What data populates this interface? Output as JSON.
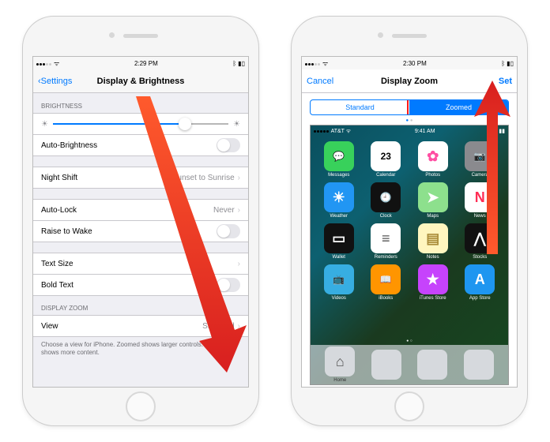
{
  "left": {
    "status": {
      "time": "2:29 PM",
      "signal_dots": 5,
      "signal_filled": 3,
      "wifi": "wifi",
      "battery": "battery"
    },
    "nav": {
      "back": "Settings",
      "title": "Display & Brightness"
    },
    "brightness": {
      "header": "BRIGHTNESS",
      "auto_label": "Auto-Brightness"
    },
    "night_shift": {
      "label": "Night Shift",
      "value": "Sunset to Sunrise"
    },
    "auto_lock": {
      "label": "Auto-Lock",
      "value": "Never"
    },
    "raise_to_wake": "Raise to Wake",
    "text_size": "Text Size",
    "bold_text": "Bold Text",
    "zoom": {
      "header": "DISPLAY ZOOM",
      "view_label": "View",
      "view_value": "Standard",
      "footer": "Choose a view for iPhone. Zoomed shows larger controls. Standard shows more content."
    }
  },
  "right": {
    "status": {
      "time": "2:30 PM"
    },
    "nav": {
      "cancel": "Cancel",
      "title": "Display Zoom",
      "set": "Set"
    },
    "segments": {
      "standard": "Standard",
      "zoomed": "Zoomed"
    },
    "preview_status": {
      "carrier": "AT&T",
      "time": "9:41 AM"
    },
    "apps": [
      {
        "label": "Messages",
        "bg": "#38d15b",
        "glyph": "💬"
      },
      {
        "label": "Calendar",
        "bg": "#ffffff",
        "glyph": "23",
        "color": "#000"
      },
      {
        "label": "Photos",
        "bg": "#ffffff",
        "glyph": "✿",
        "color": "#ff4fa3"
      },
      {
        "label": "Camera",
        "bg": "#8a8a8e",
        "glyph": "📷"
      },
      {
        "label": "Weather",
        "bg": "#2196f3",
        "glyph": "☀"
      },
      {
        "label": "Clock",
        "bg": "#111",
        "glyph": "🕘"
      },
      {
        "label": "Maps",
        "bg": "#8de08d",
        "glyph": "➤"
      },
      {
        "label": "News",
        "bg": "#ffffff",
        "glyph": "N",
        "color": "#ff2d55"
      },
      {
        "label": "Wallet",
        "bg": "#111",
        "glyph": "▭"
      },
      {
        "label": "Reminders",
        "bg": "#ffffff",
        "glyph": "≡",
        "color": "#555"
      },
      {
        "label": "Notes",
        "bg": "#fff6bf",
        "glyph": "▤",
        "color": "#aa8d3a"
      },
      {
        "label": "Stocks",
        "bg": "#111",
        "glyph": "⋀",
        "color": "#fff"
      },
      {
        "label": "Videos",
        "bg": "#37aee2",
        "glyph": "📺"
      },
      {
        "label": "iBooks",
        "bg": "#ff9500",
        "glyph": "📖"
      },
      {
        "label": "iTunes Store",
        "bg": "#c643fc",
        "glyph": "★"
      },
      {
        "label": "App Store",
        "bg": "#1e96f0",
        "glyph": "A"
      }
    ],
    "dock": [
      {
        "label": "Home",
        "bg": "#d0d0d5"
      },
      {
        "label": "",
        "bg": "#d0d0d5"
      },
      {
        "label": "",
        "bg": "#d0d0d5"
      },
      {
        "label": "",
        "bg": "#d0d0d5"
      }
    ],
    "home_label": "Home"
  }
}
